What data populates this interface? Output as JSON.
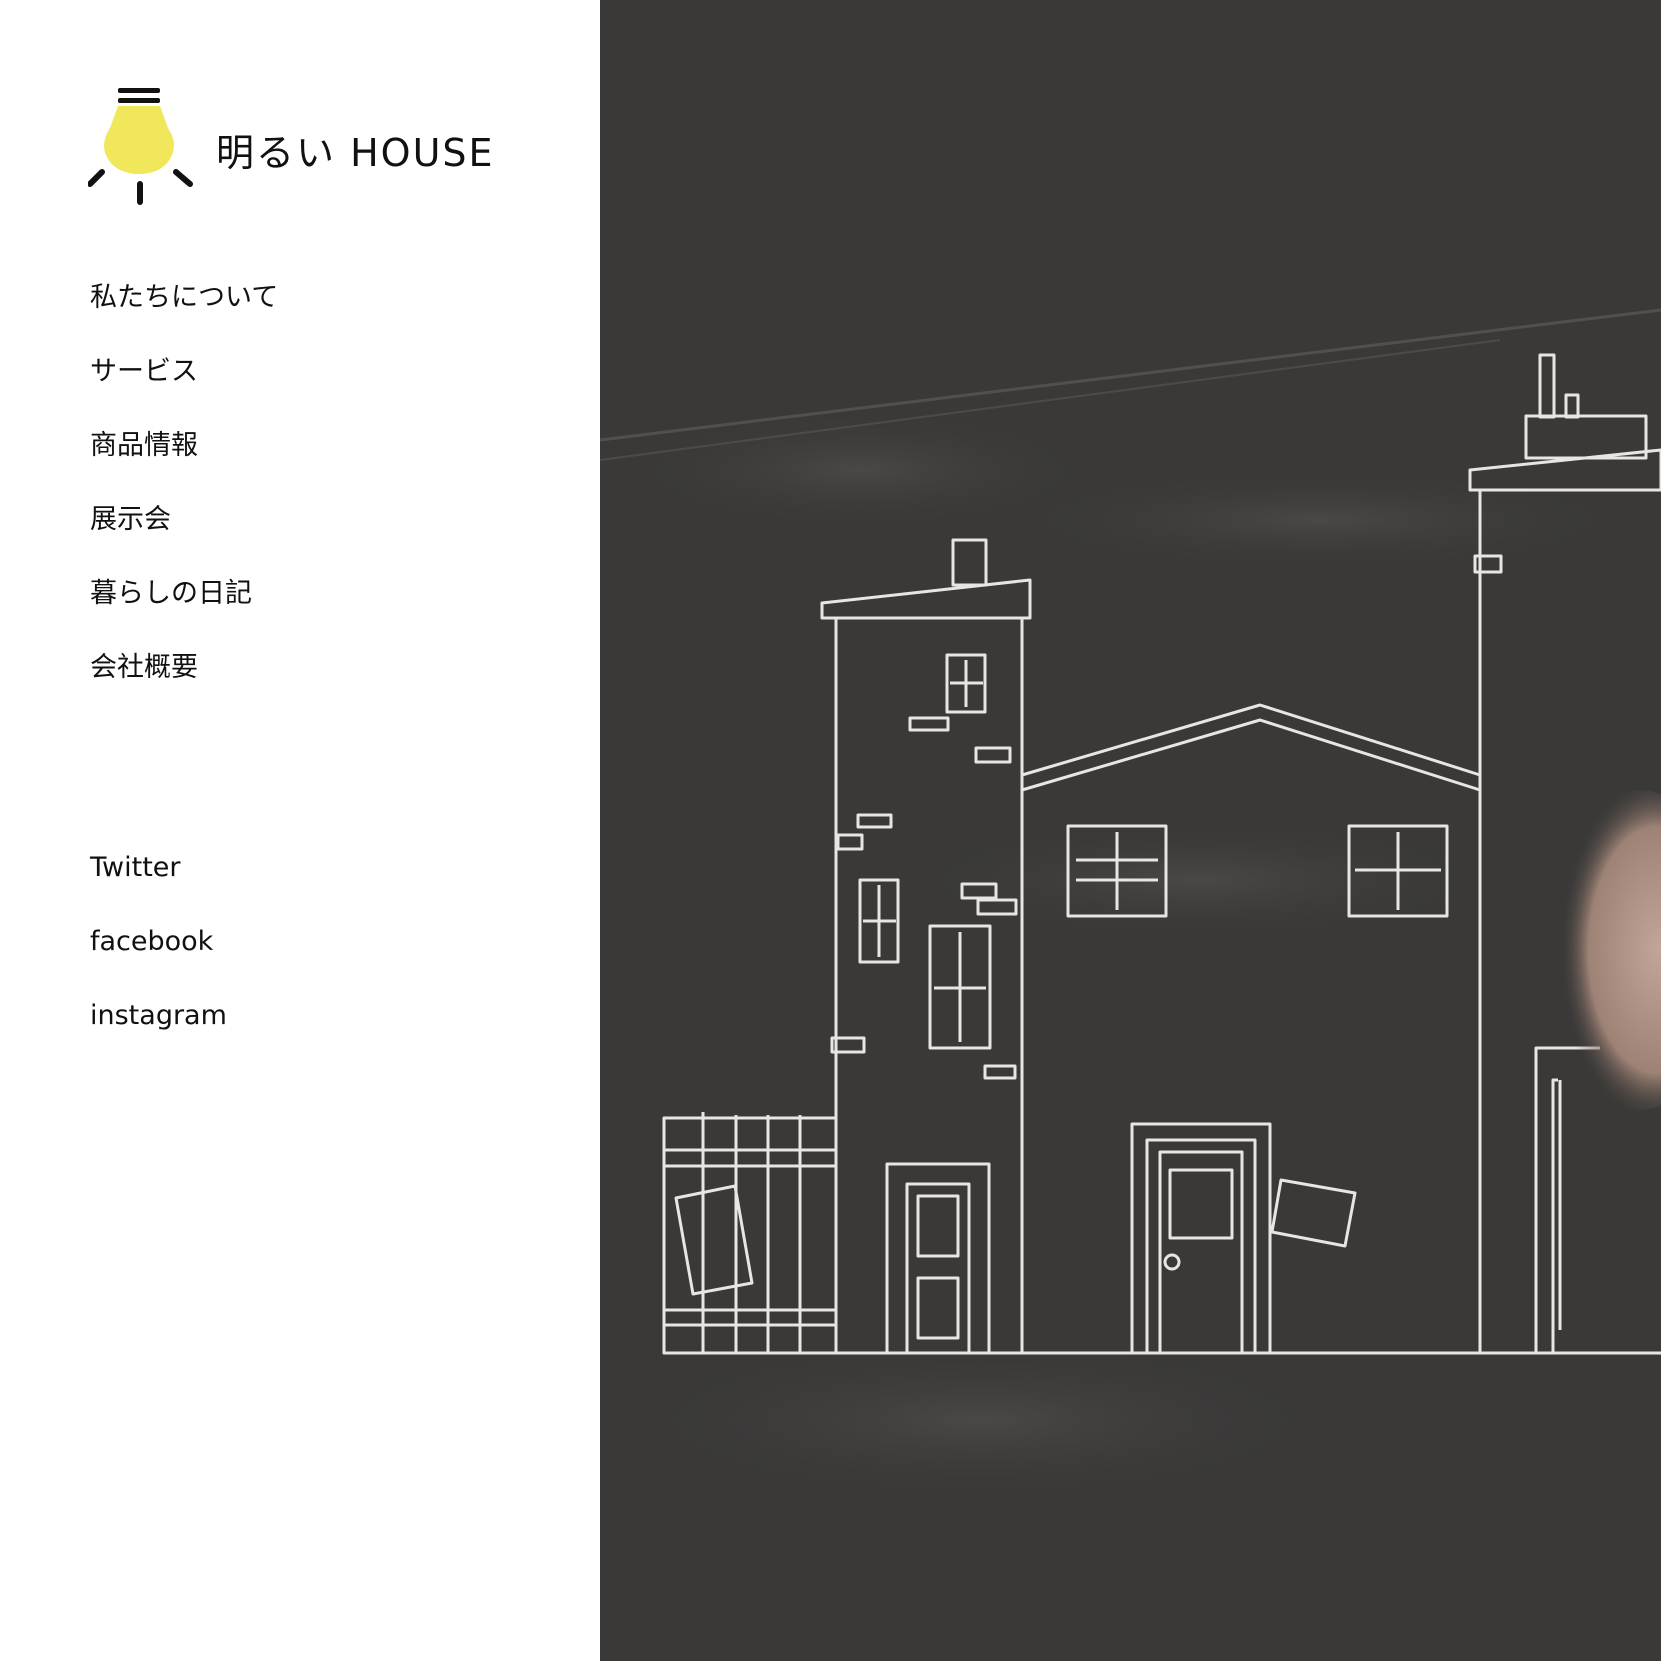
{
  "brand": {
    "name": "明るい HOUSE",
    "icon": "lightbulb-icon",
    "bulb_color": "#f0e75a"
  },
  "nav": {
    "items": [
      {
        "label": "私たちについて"
      },
      {
        "label": "サービス"
      },
      {
        "label": "商品情報"
      },
      {
        "label": "展示会"
      },
      {
        "label": "暮らしの日記"
      },
      {
        "label": "会社概要"
      }
    ]
  },
  "social": {
    "items": [
      {
        "label": "Twitter"
      },
      {
        "label": "facebook"
      },
      {
        "label": "instagram"
      }
    ]
  },
  "hero": {
    "background": "#3a3938",
    "chalk_color": "#e8e6e2",
    "image": "chalkboard-house-drawing"
  }
}
